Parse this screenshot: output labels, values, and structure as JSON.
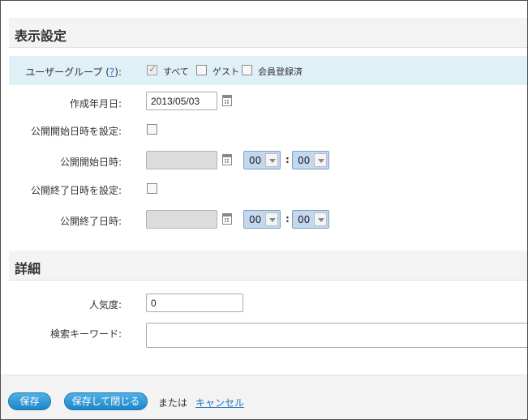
{
  "display_settings": {
    "title": "表示設定",
    "user_group": {
      "label_prefix": "ユーザーグループ (",
      "help": "?",
      "label_suffix": "):",
      "options": [
        {
          "label": "すべて",
          "checked": true
        },
        {
          "label": "ゲスト",
          "checked": false
        },
        {
          "label": "会員登録済",
          "checked": false
        }
      ]
    },
    "created_date": {
      "label": "作成年月日:",
      "value": "2013/05/03"
    },
    "set_publish_start": {
      "label": "公開開始日時を設定:"
    },
    "publish_start": {
      "label": "公開開始日時:",
      "hour": "00",
      "minute": "00",
      "separator": ":"
    },
    "set_publish_end": {
      "label": "公開終了日時を設定:"
    },
    "publish_end": {
      "label": "公開終了日時:",
      "hour": "00",
      "minute": "00",
      "separator": ":"
    }
  },
  "details": {
    "title": "詳細",
    "popularity": {
      "label": "人気度:",
      "value": "0"
    },
    "keywords": {
      "label": "検索キーワード:",
      "value": ""
    }
  },
  "footer": {
    "save_label": "保存",
    "save_close_label": "保存して閉じる",
    "or_text": "または",
    "cancel_label": "キャンセル"
  },
  "colors": {
    "highlight_row": "#dff0f7",
    "button": "#2a95d6",
    "select": "#c3d7ee",
    "link": "#1f72c2"
  }
}
